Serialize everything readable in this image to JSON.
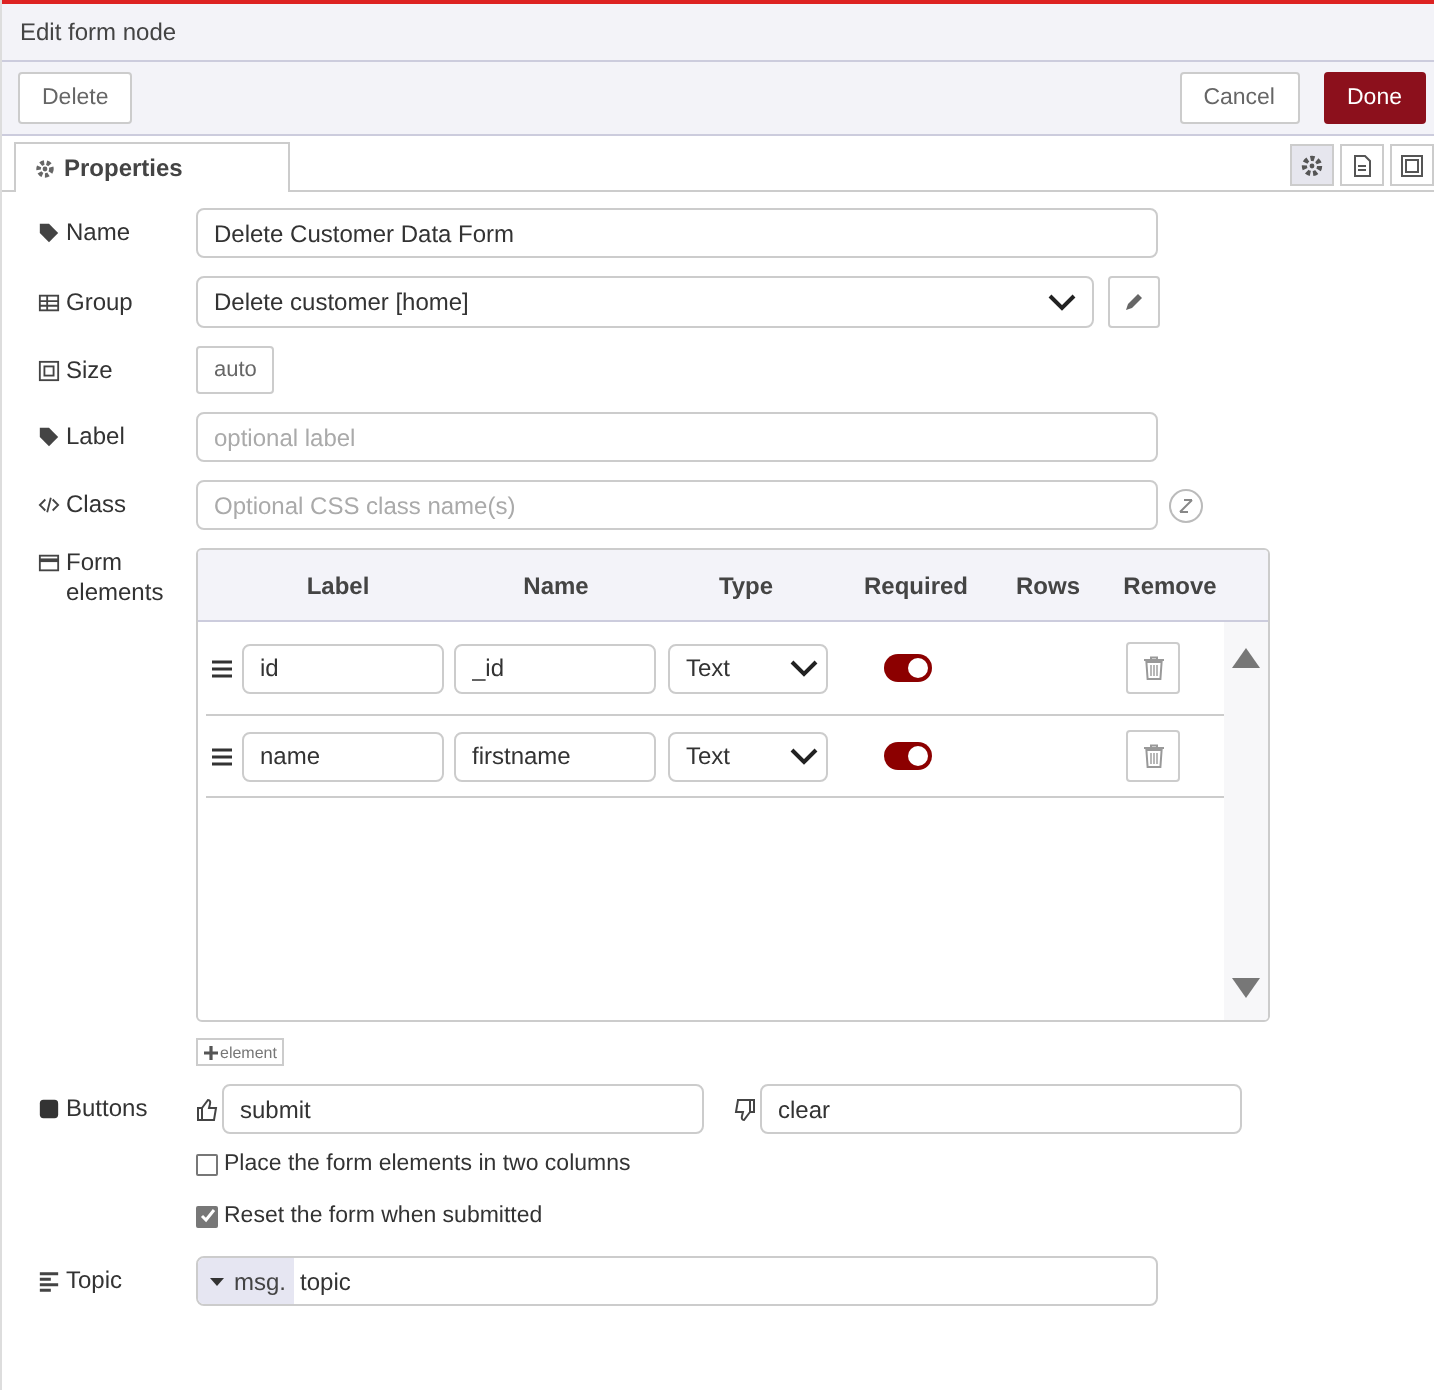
{
  "window": {
    "title": "Edit form node"
  },
  "toolbar": {
    "delete": "Delete",
    "cancel": "Cancel",
    "done": "Done"
  },
  "tabs": [
    {
      "label": "Properties",
      "selected": true
    }
  ],
  "side_tabs": [
    {
      "kind": "gear",
      "selected": true
    },
    {
      "kind": "doc",
      "selected": false
    },
    {
      "kind": "frame",
      "selected": false
    }
  ],
  "fields": {
    "name": {
      "label": "Name",
      "value": "Delete Customer Data Form"
    },
    "group": {
      "label": "Group",
      "value": "Delete customer [home]"
    },
    "size": {
      "label": "Size",
      "value": "auto"
    },
    "label": {
      "label": "Label",
      "placeholder": "optional label"
    },
    "class": {
      "label": "Class",
      "placeholder": "Optional CSS class name(s)"
    }
  },
  "form_elements": {
    "label": "Form elements",
    "columns": [
      "Label",
      "Name",
      "Type",
      "Required",
      "Rows",
      "Remove"
    ],
    "rows": [
      {
        "label": "id",
        "name": "_id",
        "type": "Text",
        "required": true
      },
      {
        "label": "name",
        "name": "firstname",
        "type": "Text",
        "required": true
      }
    ],
    "add_button": "element"
  },
  "buttons": {
    "label": "Buttons",
    "submit": "submit",
    "clear": "clear"
  },
  "options": [
    {
      "label": "Place the form elements in two columns",
      "checked": false
    },
    {
      "label": "Reset the form when submitted",
      "checked": true
    }
  ],
  "topic": {
    "label": "Topic",
    "prefix": "msg.",
    "value": "topic"
  }
}
